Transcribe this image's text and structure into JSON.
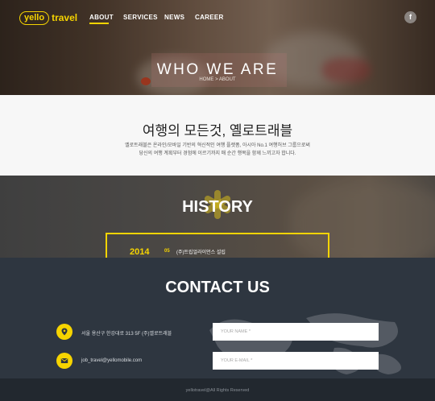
{
  "header": {
    "logo_pill": "yello",
    "logo_word": "travel",
    "nav": [
      {
        "label": "ABOUT",
        "active": true
      },
      {
        "label": "SERVICES",
        "active": false
      },
      {
        "label": "NEWS",
        "active": false
      },
      {
        "label": "CAREER",
        "active": false
      }
    ],
    "social_icon": "facebook-icon",
    "social_glyph": "f",
    "accent_color": "#f6d400"
  },
  "hero": {
    "title": "WHO WE ARE",
    "breadcrumb": "HOME  >  ABOUT"
  },
  "intro": {
    "heading": "여행의 모든것, 옐로트래블",
    "line1": "옐로트래블은 온라인/모바일 기반의 혁신적인 여행 플랫폼, 아시아 No.1 여행허브 그룹으로써",
    "line2": "당신의 여행 계획부터 경험에 이르기까지 매 순간 행복을 함께 느끼고자 합니다."
  },
  "history": {
    "title": "HISTORY",
    "entries": [
      {
        "year": "2014",
        "month": "05",
        "text": "(주)트립얼라이언스 설립"
      }
    ]
  },
  "contact": {
    "title": "CONTACT US",
    "address": "서울 용산구 한강대로 313 5F (주)옐로트래블",
    "email": "job_travel@yellomobile.com",
    "address_icon": "location-pin-icon",
    "email_icon": "envelope-icon",
    "name_placeholder": "YOUR NAME *",
    "email_placeholder": "YOUR E-MAIL *"
  },
  "footer": {
    "copyright": "yellotravel@All Rights Reserved"
  }
}
